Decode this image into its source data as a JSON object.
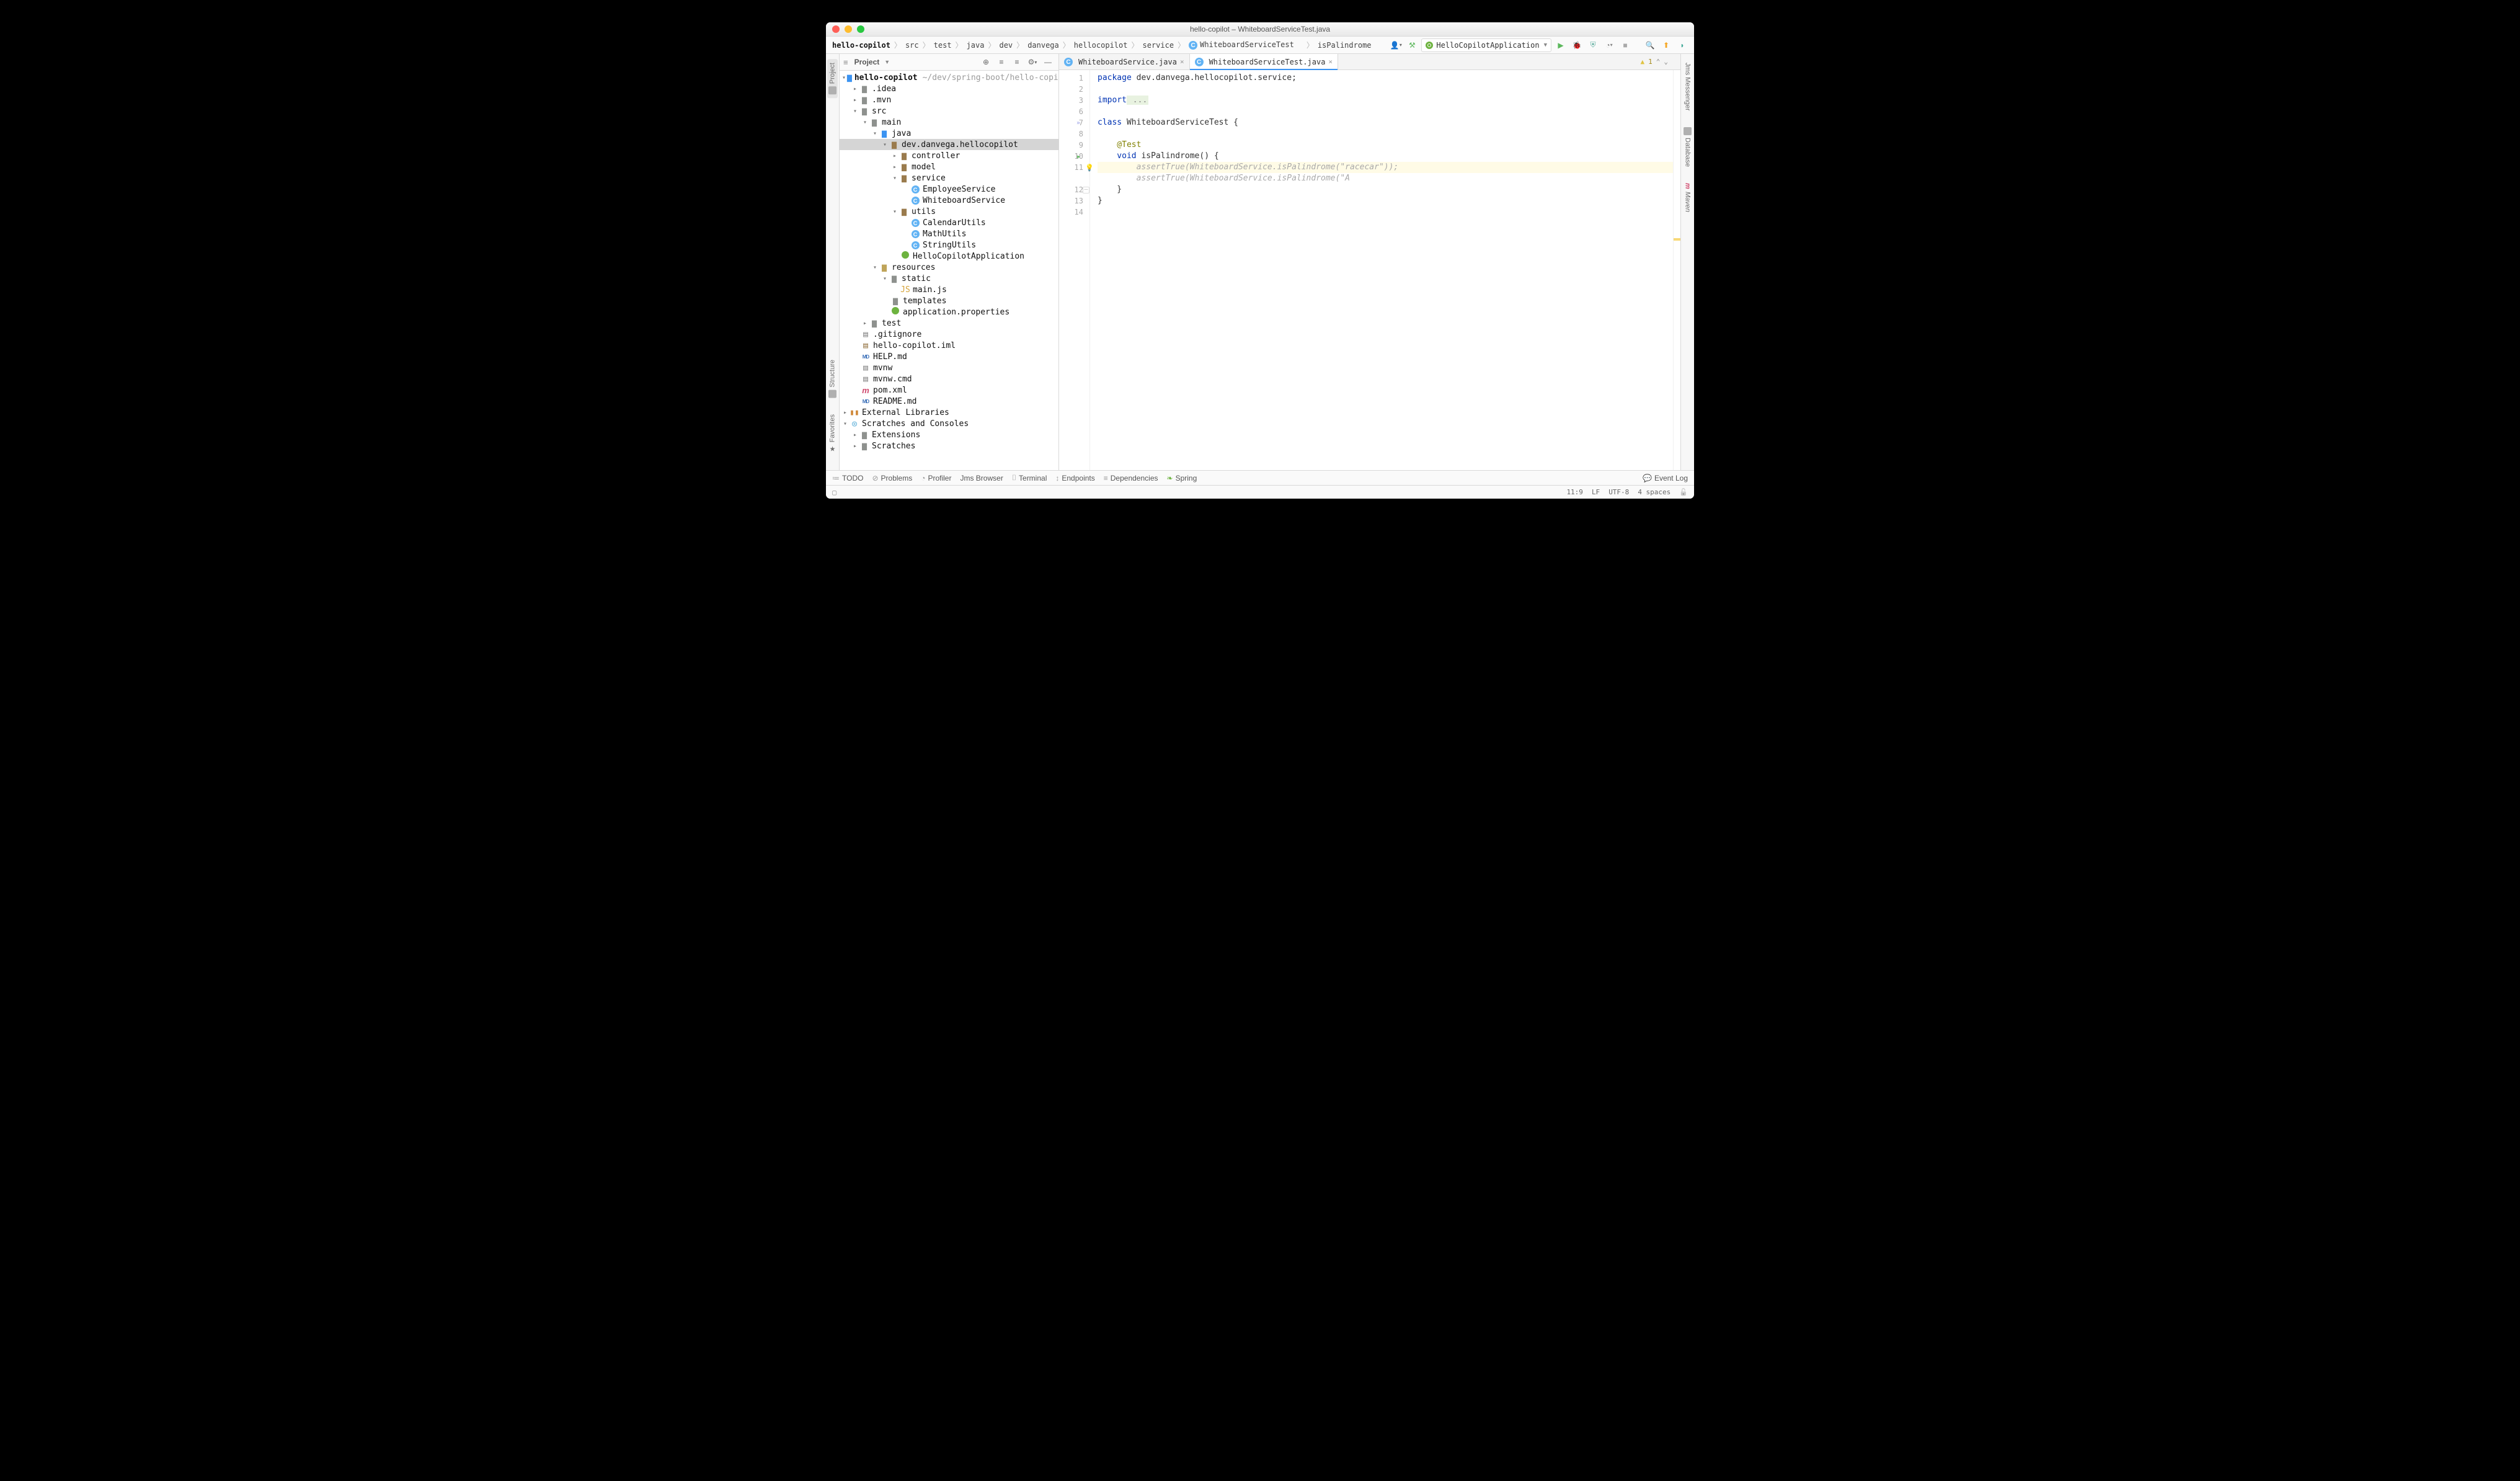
{
  "window_title": "hello-copilot – WhiteboardServiceTest.java",
  "breadcrumbs": [
    "hello-copilot",
    "src",
    "test",
    "java",
    "dev",
    "danvega",
    "hellocopilot",
    "service",
    "WhiteboardServiceTest",
    "isPalindrome"
  ],
  "run_config": "HelloCopilotApplication",
  "left_tabs": {
    "project": "Project",
    "structure": "Structure",
    "favorites": "Favorites"
  },
  "right_tabs": {
    "jms": "Jms Messenger",
    "database": "Database",
    "maven": "Maven"
  },
  "pane_title": "Project",
  "project_path": "~/dev/spring-boot/hello-copilot",
  "tree": {
    "root": "hello-copilot",
    "idea": ".idea",
    "mvn": ".mvn",
    "src": "src",
    "main": "main",
    "java": "java",
    "pkg": "dev.danvega.hellocopilot",
    "controller": "controller",
    "model": "model",
    "service": "service",
    "EmployeeService": "EmployeeService",
    "WhiteboardService": "WhiteboardService",
    "utils": "utils",
    "CalendarUtils": "CalendarUtils",
    "MathUtils": "MathUtils",
    "StringUtils": "StringUtils",
    "app": "HelloCopilotApplication",
    "resources": "resources",
    "static": "static",
    "mainjs": "main.js",
    "templates": "templates",
    "appprops": "application.properties",
    "test": "test",
    "gitignore": ".gitignore",
    "iml": "hello-copilot.iml",
    "help": "HELP.md",
    "mvnw": "mvnw",
    "mvnwcmd": "mvnw.cmd",
    "pom": "pom.xml",
    "readme": "README.md",
    "extlib": "External Libraries",
    "scratches": "Scratches and Consoles",
    "extensions": "Extensions",
    "scratches2": "Scratches"
  },
  "editor_tabs": {
    "t1": "WhiteboardService.java",
    "t2": "WhiteboardServiceTest.java"
  },
  "line_numbers": [
    "1",
    "2",
    "3",
    "6",
    "7",
    "8",
    "9",
    "10",
    "11",
    "12",
    "13",
    "14"
  ],
  "code": {
    "l1_kw": "package",
    "l1_rest": " dev.danvega.hellocopilot.service;",
    "l3_kw": "import",
    "l3_rest": " ...",
    "l7_kw": "class",
    "l7_rest": " WhiteboardServiceTest {",
    "l9": "    @Test",
    "l10_kw": "    void",
    "l10_rest": " isPalindrome() {",
    "l11": "        assertTrue(WhiteboardService.isPalindrome(\"racecar\"));",
    "l11b": "        assertTrue(WhiteboardService.isPalindrome(\"A",
    "l12": "    }",
    "l13": "}"
  },
  "analysis": {
    "warn_count": "1"
  },
  "bottom": {
    "todo": "TODO",
    "problems": "Problems",
    "profiler": "Profiler",
    "jms": "Jms Browser",
    "terminal": "Terminal",
    "endpoints": "Endpoints",
    "dependencies": "Dependencies",
    "spring": "Spring",
    "eventlog": "Event Log"
  },
  "status": {
    "cursor": "11:9",
    "eol": "LF",
    "enc": "UTF-8",
    "indent": "4 spaces"
  }
}
